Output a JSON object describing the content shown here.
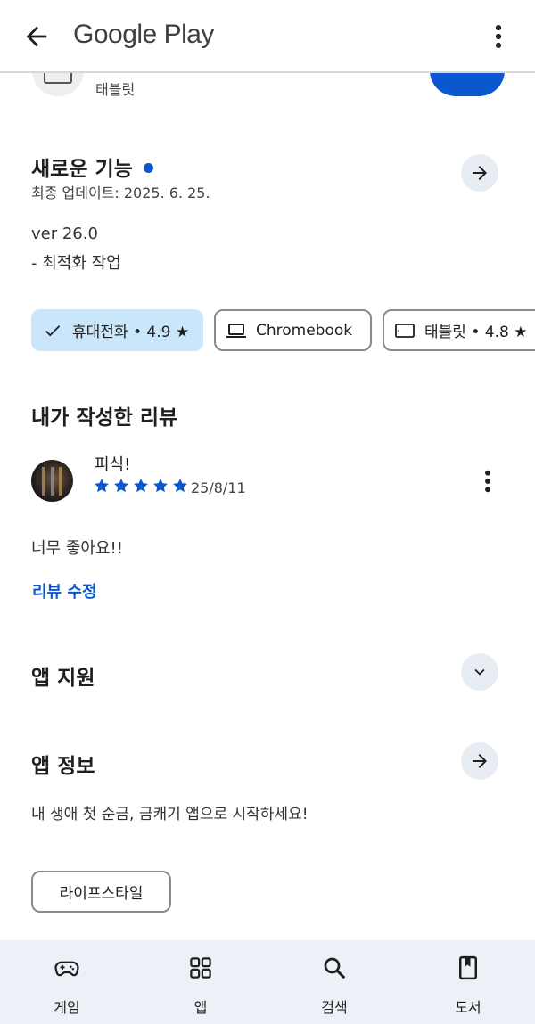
{
  "app_bar": {
    "title": "Google Play",
    "back_icon": "arrow-back-icon",
    "more_icon": "more-vert-icon"
  },
  "top_strip": {
    "device_label": "태블릿"
  },
  "whats_new": {
    "title": "새로운 기능",
    "updated": "최종 업데이트: 2025. 6. 25.",
    "version": "ver 26.0",
    "notes": "- 최적화 작업",
    "accent_color": "#0b57d0"
  },
  "device_chips": [
    {
      "label": "휴대전화 • 4.9 ★",
      "icon": "check-icon",
      "selected": true
    },
    {
      "label": "Chromebook",
      "icon": "laptop-icon",
      "selected": false
    },
    {
      "label": "태블릿 • 4.8 ★",
      "icon": "tablet-icon",
      "selected": false
    }
  ],
  "my_review": {
    "title": "내가 작성한 리뷰",
    "reviewer": "피식!",
    "rating": 5,
    "date": "25/8/11",
    "text": "너무 좋아요!!",
    "edit_link": "리뷰 수정"
  },
  "app_support": {
    "title": "앱 지원"
  },
  "app_info": {
    "title": "앱 정보",
    "description": "내 생애 첫 순금, 금캐기 앱으로 시작하세요!",
    "category_tag": "라이프스타일"
  },
  "bottom_nav": [
    {
      "label": "게임",
      "icon": "gamepad-icon"
    },
    {
      "label": "앱",
      "icon": "apps-grid-icon"
    },
    {
      "label": "검색",
      "icon": "search-icon"
    },
    {
      "label": "도서",
      "icon": "book-icon"
    }
  ]
}
